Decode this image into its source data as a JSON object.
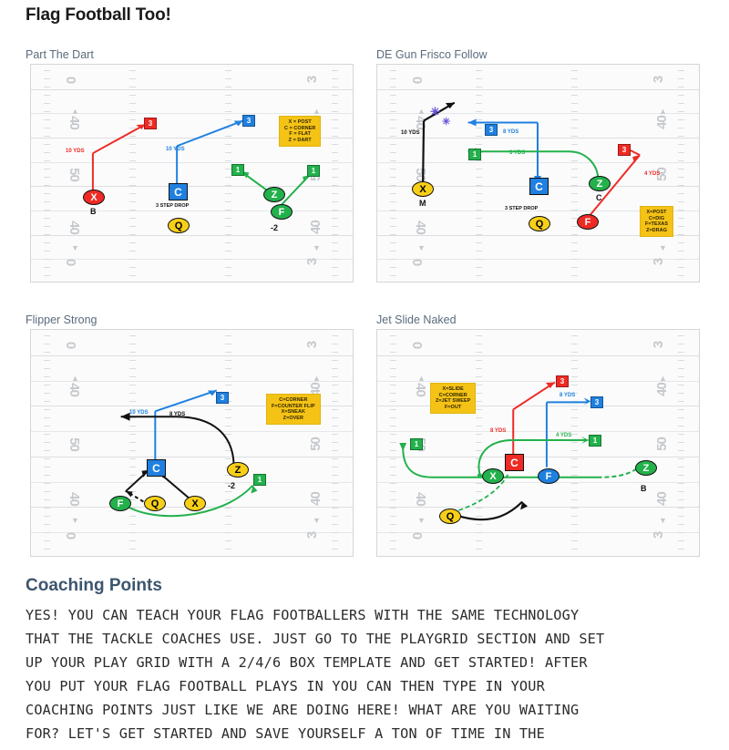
{
  "header": {
    "title": "Flag Football Too!"
  },
  "plays": [
    {
      "title": "Part The Dart",
      "legend": [
        "X = POST",
        "C = CORNER",
        "F = FLAT",
        "Z = DART"
      ],
      "tokens": [
        {
          "label": "X",
          "color": "red",
          "shape": "oval",
          "note": "B"
        },
        {
          "label": "C",
          "color": "blue",
          "shape": "sq",
          "note": "3 STEP DROP"
        },
        {
          "label": "Q",
          "color": "yellow",
          "shape": "oval",
          "note": ""
        },
        {
          "label": "Z",
          "color": "green",
          "shape": "oval",
          "note": ""
        },
        {
          "label": "F",
          "color": "green",
          "shape": "oval",
          "note": "-2"
        }
      ],
      "depth_labels": [
        "10 YDS",
        "10 YDS"
      ]
    },
    {
      "title": "DE Gun Frisco Follow",
      "legend": [
        "X=POST",
        "C=DIG",
        "F=TEXAS",
        "Z=DRAG"
      ],
      "tokens": [
        {
          "label": "X",
          "color": "yellow",
          "shape": "oval",
          "note": "M"
        },
        {
          "label": "C",
          "color": "blue",
          "shape": "sq",
          "note": "3 STEP DROP"
        },
        {
          "label": "Q",
          "color": "yellow",
          "shape": "oval",
          "note": ""
        },
        {
          "label": "Z",
          "color": "green",
          "shape": "oval",
          "note": "C"
        },
        {
          "label": "F",
          "color": "red",
          "shape": "oval",
          "note": ""
        }
      ],
      "depth_labels": [
        "10 YDS",
        "8 YDS",
        "3 YDS",
        "4 YDS"
      ]
    },
    {
      "title": "Flipper Strong",
      "legend": [
        "C=CORNER",
        "F=COUNTER FLIP",
        "X=SNEAK",
        "Z=OVER"
      ],
      "tokens": [
        {
          "label": "C",
          "color": "blue",
          "shape": "sq",
          "note": ""
        },
        {
          "label": "Z",
          "color": "yellow",
          "shape": "oval",
          "note": "-2"
        },
        {
          "label": "F",
          "color": "green",
          "shape": "oval",
          "note": ""
        },
        {
          "label": "Q",
          "color": "yellow",
          "shape": "oval",
          "note": ""
        },
        {
          "label": "X",
          "color": "yellow",
          "shape": "oval",
          "note": ""
        }
      ],
      "depth_labels": [
        "10 YDS",
        "8 YDS"
      ]
    },
    {
      "title": "Jet Slide Naked",
      "legend": [
        "X=SLIDE",
        "C=CORNER",
        "Z=JET SWEEP",
        "F=OUT"
      ],
      "tokens": [
        {
          "label": "C",
          "color": "red",
          "shape": "sq",
          "note": ""
        },
        {
          "label": "X",
          "color": "green",
          "shape": "oval",
          "note": ""
        },
        {
          "label": "F",
          "color": "blue",
          "shape": "oval",
          "note": ""
        },
        {
          "label": "Z",
          "color": "green",
          "shape": "oval",
          "note": "B"
        },
        {
          "label": "Q",
          "color": "yellow",
          "shape": "oval",
          "note": ""
        }
      ],
      "depth_labels": [
        "8 YDS",
        "8 YDS",
        "4 YDS"
      ]
    }
  ],
  "field": {
    "yard_numbers_left": [
      "0",
      "40",
      "50",
      "40",
      "0"
    ],
    "yard_numbers_right": [
      "3",
      "40",
      "50",
      "40",
      "3"
    ]
  },
  "coaching": {
    "title": "Coaching Points",
    "lines": [
      "YES! YOU CAN TEACH YOUR FLAG FOOTBALLERS WITH THE SAME TECHNOLOGY",
      "THAT THE TACKLE COACHES USE. JUST GO TO THE PLAYGRID SECTION AND SET",
      "UP YOUR PLAY GRID WITH A 2/4/6 BOX TEMPLATE AND GET STARTED! AFTER",
      "YOU PUT YOUR FLAG FOOTBALL PLAYS IN YOU CAN THEN TYPE IN YOUR",
      "COACHING POINTS JUST LIKE WE ARE DOING HERE! WHAT ARE YOU WAITING",
      "FOR? LET'S GET STARTED AND SAVE YOURSELF A TON OF TIME IN THE"
    ]
  },
  "colors": {
    "red": "#ef2a24",
    "blue": "#1f80e0",
    "green": "#23b14c",
    "yellow": "#f7cf19",
    "legend_bg": "#f5c316",
    "heading": "#3c556e",
    "play_title": "#5a6b7d"
  }
}
